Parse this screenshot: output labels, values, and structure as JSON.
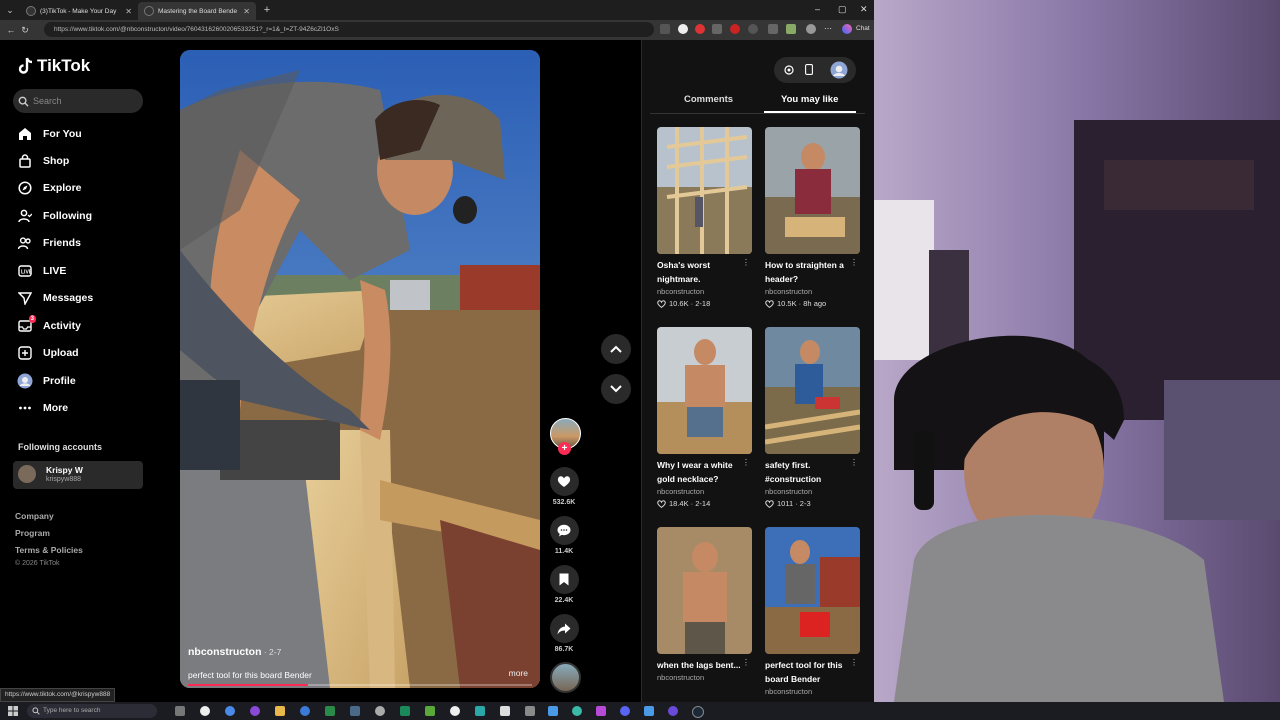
{
  "browser": {
    "tabs": [
      {
        "title": "(3)TikTok - Make Your Day",
        "active": false
      },
      {
        "title": "Mastering the Board Bender ✗",
        "active": true
      }
    ],
    "url": "https://www.tiktok.com/@nbconstructon/video/76043162600206533251?_r=1&_t=ZT-94Z6cZl1OxS",
    "chat_label": "Chat",
    "status_url": "https://www.tiktok.com/@krispyw888"
  },
  "sidebar": {
    "logo": "TikTok",
    "search_placeholder": "Search",
    "nav": [
      {
        "label": "For You",
        "icon": "home-icon"
      },
      {
        "label": "Shop",
        "icon": "shop-bag-icon"
      },
      {
        "label": "Explore",
        "icon": "compass-icon"
      },
      {
        "label": "Following",
        "icon": "following-user-icon"
      },
      {
        "label": "Friends",
        "icon": "friends-icon"
      },
      {
        "label": "LIVE",
        "icon": "live-icon"
      },
      {
        "label": "Messages",
        "icon": "paper-plane-icon"
      },
      {
        "label": "Activity",
        "icon": "inbox-icon",
        "badge": "3"
      },
      {
        "label": "Upload",
        "icon": "plus-square-icon"
      },
      {
        "label": "Profile",
        "icon": "profile-avatar-icon"
      },
      {
        "label": "More",
        "icon": "more-dots-icon"
      }
    ],
    "following_header": "Following accounts",
    "account": {
      "name": "Krispy W",
      "handle": "krispyw888"
    },
    "footer_links": [
      "Company",
      "Program",
      "Terms & Policies"
    ],
    "copyright": "© 2026 TikTok"
  },
  "video": {
    "author": "nbconstructon",
    "date": " · 2-7",
    "description": "perfect tool for this board Bender",
    "more_label": "more",
    "progress": 0.35
  },
  "actions": {
    "likes": "532.6K",
    "comments": "11.4K",
    "saves": "22.4K",
    "shares": "86.7K"
  },
  "right_panel": {
    "tab_comments": "Comments",
    "tab_you_may_like": "You may like",
    "cards": [
      {
        "title": "Osha's worst nightmare.",
        "author": "nbconstructon",
        "stats": "10.6K · 2-18"
      },
      {
        "title": "How to straighten a header?",
        "author": "nbconstructon",
        "stats": "10.5K · 8h ago"
      },
      {
        "title": "Why I wear a white gold necklace?",
        "author": "nbconstructon",
        "stats": "18.4K · 2-14"
      },
      {
        "title": "safety first. #construction",
        "author": "nbconstructon",
        "stats": "1011 · 2-3"
      },
      {
        "title": "when the lags bent...",
        "author": "nbconstructon",
        "stats": ""
      },
      {
        "title": "perfect tool for this board Bender",
        "author": "nbconstructon",
        "stats": ""
      }
    ]
  },
  "taskbar": {
    "search_placeholder": "Type here to search"
  },
  "colors": {
    "accent": "#fe2c55",
    "background": "#000000",
    "panel": "#121212"
  }
}
